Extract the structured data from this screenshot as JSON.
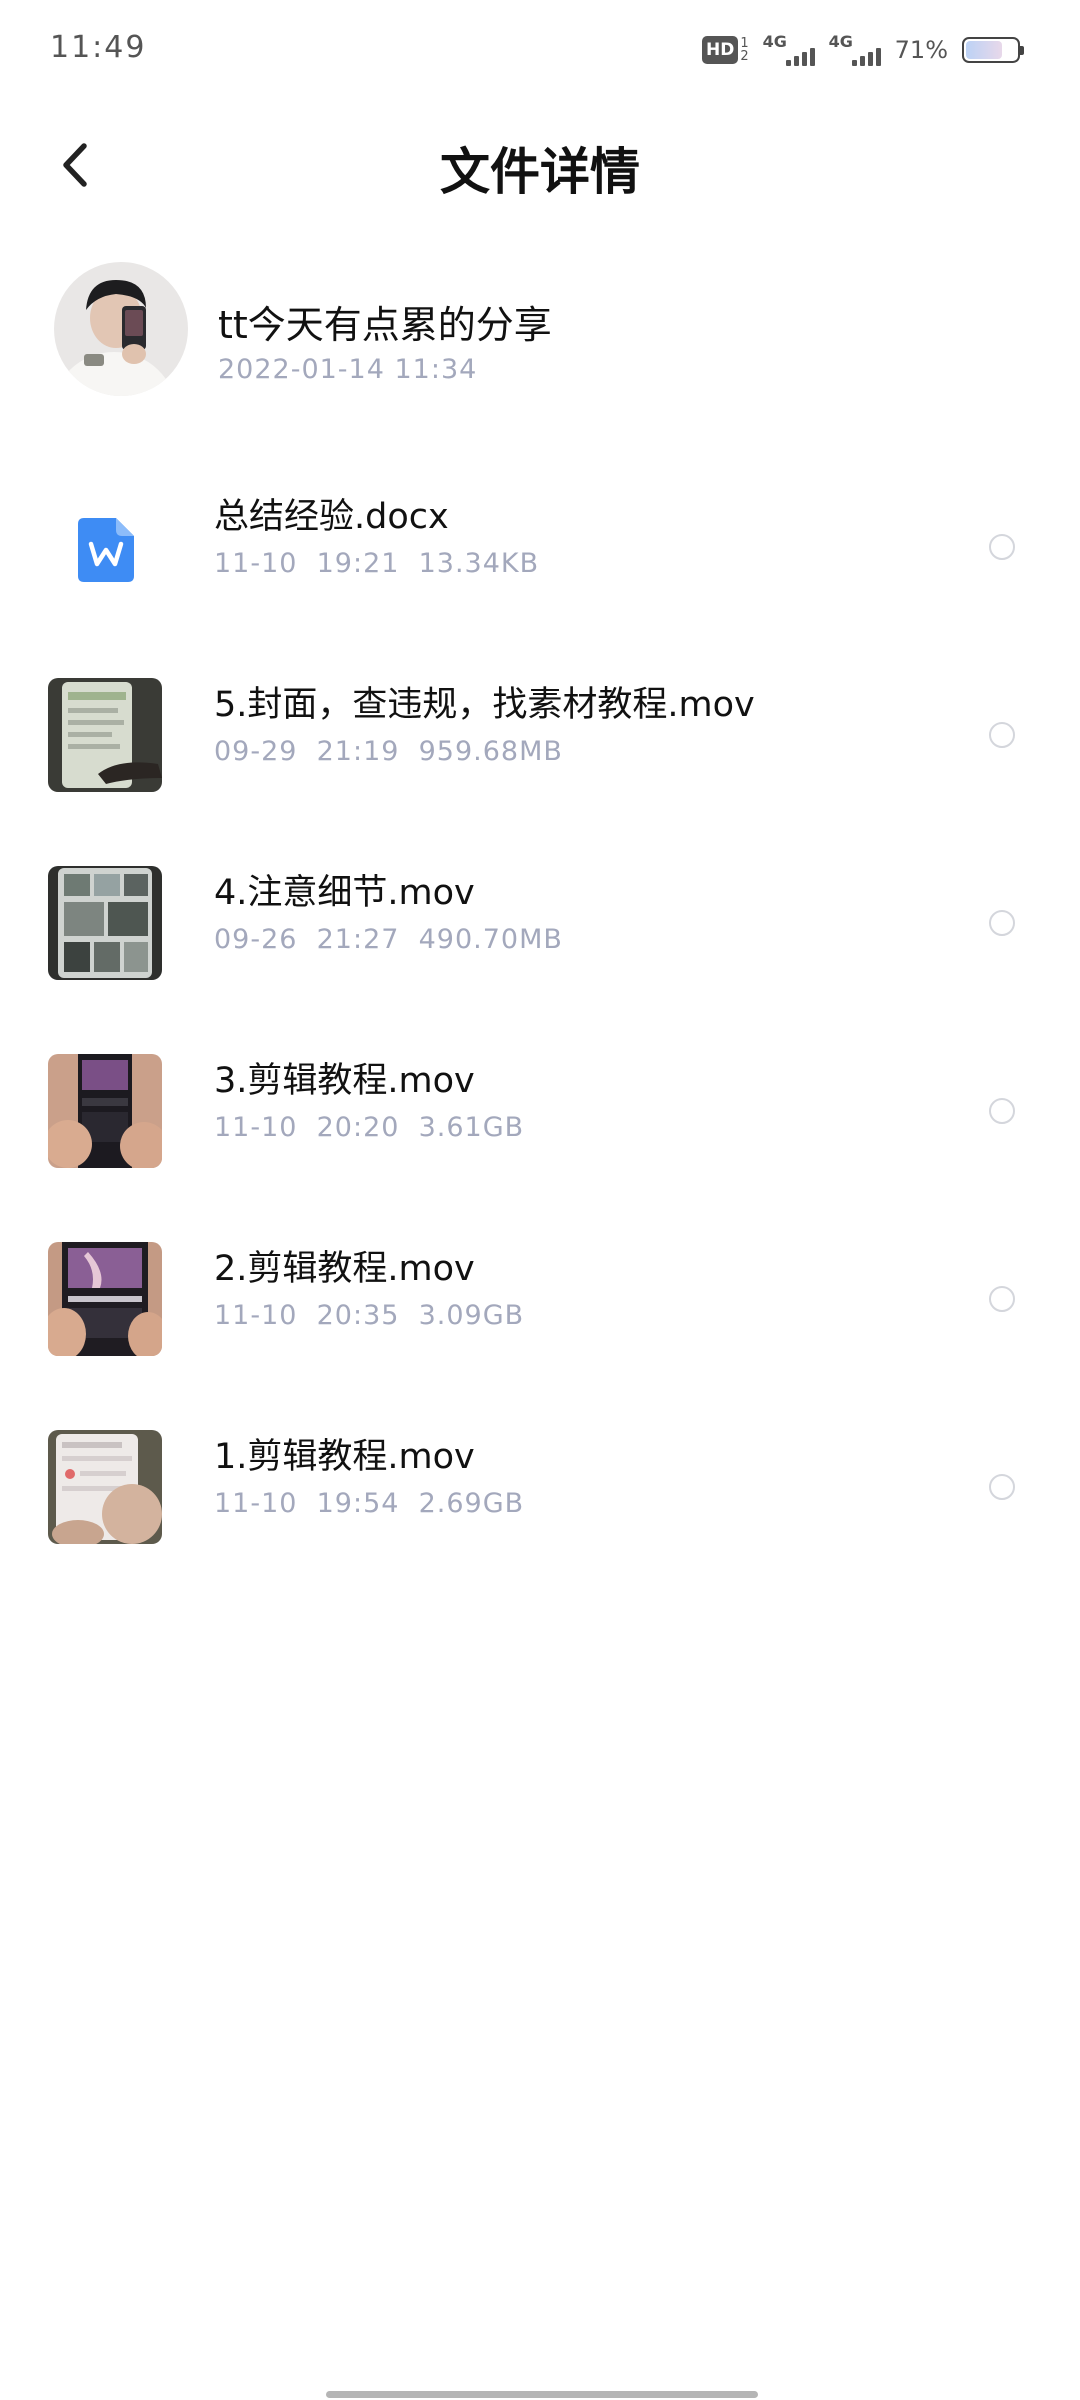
{
  "status_bar": {
    "time": "11:49",
    "hd_label": "HD",
    "hd_sub_top": "1",
    "hd_sub_bottom": "2",
    "signal_1_label": "4G",
    "signal_2_label": "4G",
    "battery_percent": "71%",
    "battery_level": 0.71
  },
  "header": {
    "title": "文件详情",
    "back_icon": "chevron-left-icon"
  },
  "sender": {
    "name": "tt今天有点累的分享",
    "timestamp": "2022-01-14  11:34"
  },
  "files": [
    {
      "name": "总结经验.docx",
      "meta": "11-10  19:21  13.34KB",
      "kind": "word-document"
    },
    {
      "name": "5.封面，查违规，找素材教程.mov",
      "meta": "09-29  21:19  959.68MB",
      "kind": "video"
    },
    {
      "name": "4.注意细节.mov",
      "meta": "09-26  21:27  490.70MB",
      "kind": "video"
    },
    {
      "name": "3.剪辑教程.mov",
      "meta": "11-10  20:20  3.61GB",
      "kind": "video"
    },
    {
      "name": "2.剪辑教程.mov",
      "meta": "11-10  20:35  3.09GB",
      "kind": "video"
    },
    {
      "name": "1.剪辑教程.mov",
      "meta": "11-10  19:54  2.69GB",
      "kind": "video"
    }
  ],
  "colors": {
    "meta_text": "#a3a8bc",
    "doc_icon_blue": "#3e8cf4",
    "radio_border": "#d4d6dc"
  }
}
